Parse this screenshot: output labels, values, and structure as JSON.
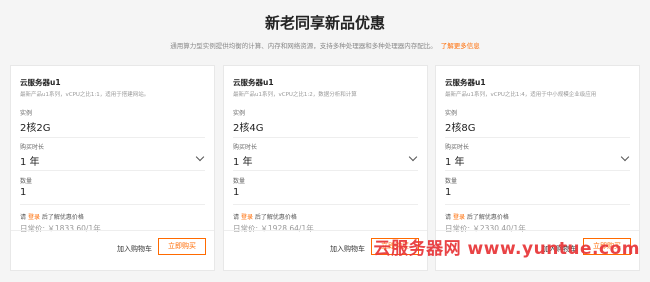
{
  "header": {
    "title": "新老同享新品优惠",
    "subtitle": "通用算力型实例提供均衡的计算、内存和网络资源，支持多种处理器和多种处理器内存配比。",
    "link": "了解更多信息"
  },
  "cards": [
    {
      "name": "云服务器u1",
      "desc": "最新产品u1系列，vCPU之比1:1，适用于搭建网站。",
      "instance_label": "实例",
      "instance_value": "2核2G",
      "duration_label": "购买时长",
      "duration_value": "1 年",
      "quantity_label": "数量",
      "quantity_value": "1",
      "hint_pre": "请",
      "hint_login": "登录",
      "hint_post": "后了解优惠价格",
      "price": "日常价: ￥1833.60/1年",
      "cart_label": "加入购物车",
      "buy_label": "立即购买"
    },
    {
      "name": "云服务器u1",
      "desc": "最新产品u1系列，vCPU之比1:2，数据分析和计算",
      "instance_label": "实例",
      "instance_value": "2核4G",
      "duration_label": "购买时长",
      "duration_value": "1 年",
      "quantity_label": "数量",
      "quantity_value": "1",
      "hint_pre": "请",
      "hint_login": "登录",
      "hint_post": "后了解优惠价格",
      "price": "日常价: ￥1928.64/1年",
      "cart_label": "加入购物车",
      "buy_label": "立即购买"
    },
    {
      "name": "云服务器u1",
      "desc": "最新产品u1系列，vCPU之比1:4，适用于中小规模企业级应用",
      "instance_label": "实例",
      "instance_value": "2核8G",
      "duration_label": "购买时长",
      "duration_value": "1 年",
      "quantity_label": "数量",
      "quantity_value": "1",
      "hint_pre": "请",
      "hint_login": "登录",
      "hint_post": "后了解优惠价格",
      "price": "日常价: ￥2330.40/1年",
      "cart_label": "加入购物车",
      "buy_label": "立即购买"
    }
  ],
  "watermark": "云服务器网 www.yuntue.com",
  "colors": {
    "accent": "#ff6a00",
    "watermark": "#e8393c"
  }
}
